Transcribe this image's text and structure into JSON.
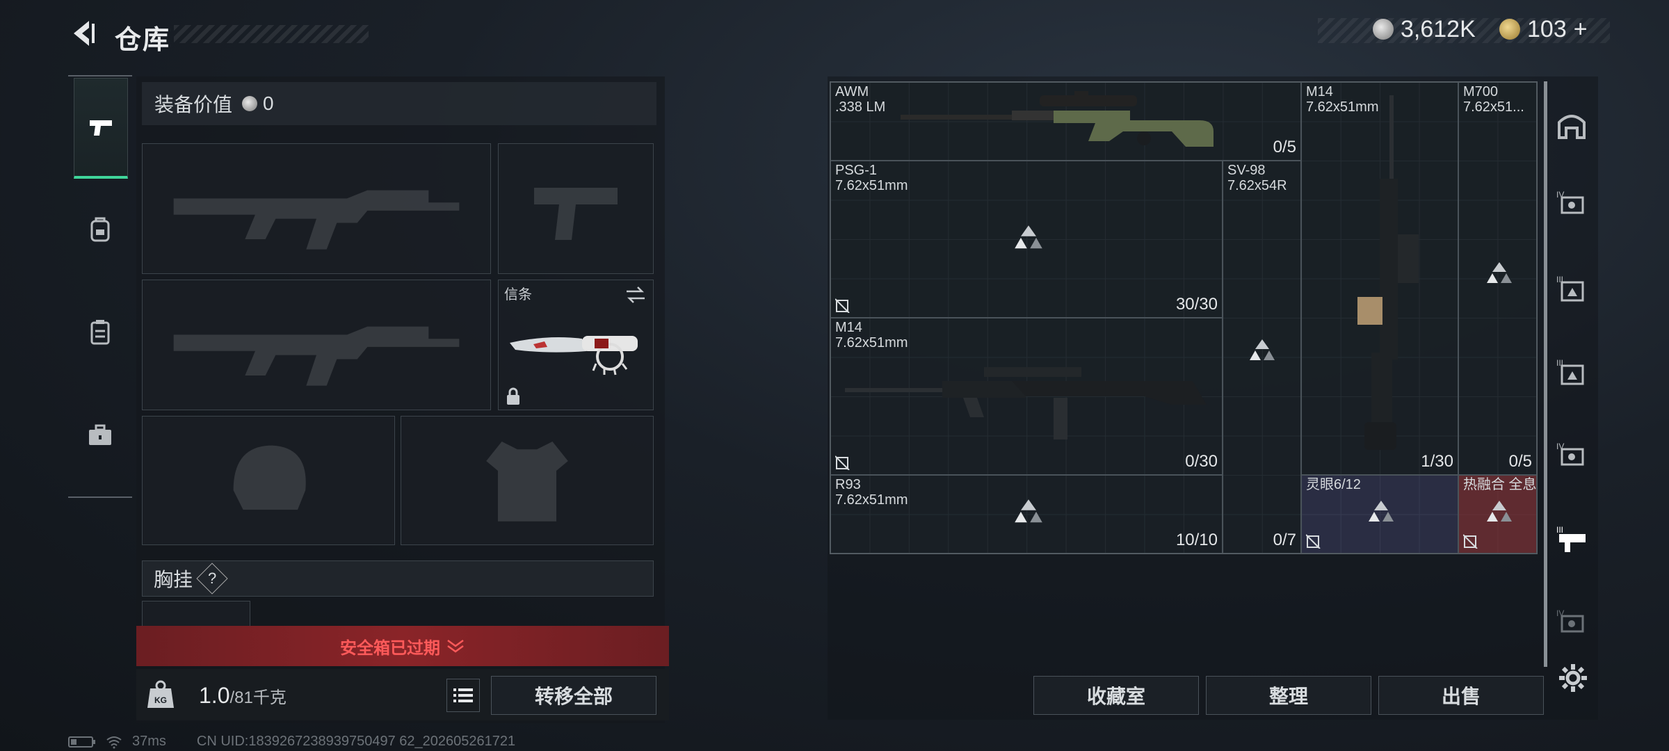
{
  "header": {
    "title": "仓库"
  },
  "currency": {
    "silver": "3,612K",
    "gold": "103",
    "gold_plus": "+"
  },
  "loadout": {
    "equip_value_label": "装备价值",
    "equip_value": "0",
    "token_slot_label": "信条",
    "chest_rig_label": "胸挂",
    "chest_rig_hint": "?",
    "safebox_status": "安全箱已过期",
    "weight_current": "1.0",
    "weight_max": "/81千克",
    "weight_icon_text": "KG",
    "transfer_all_label": "转移全部"
  },
  "status": {
    "ping": "37ms",
    "uid": "CN UID:1839267238939750497 62_202605261721"
  },
  "storage": {
    "items": [
      {
        "name": "AWM\n.338 LM",
        "count": "0/5"
      },
      {
        "name": "M14\n7.62x51mm",
        "count": "1/30"
      },
      {
        "name": "M700\n7.62x51...",
        "count": "0/5"
      },
      {
        "name": "PSG-1\n7.62x51mm",
        "count": "30/30"
      },
      {
        "name": "SV-98\n7.62x54R",
        "count": "0/7"
      },
      {
        "name": "M14\n7.62x51mm",
        "count": "0/30"
      },
      {
        "name": "R93\n7.62x51mm",
        "count": "10/10"
      },
      {
        "name": "灵眼6/12",
        "count": ""
      },
      {
        "name": "热融合 全息",
        "count": ""
      }
    ]
  },
  "actions": {
    "collection": "收藏室",
    "organize": "整理",
    "sell": "出售"
  },
  "colors": {
    "accent": "#3fd59a",
    "warning": "#ff5a5a"
  }
}
